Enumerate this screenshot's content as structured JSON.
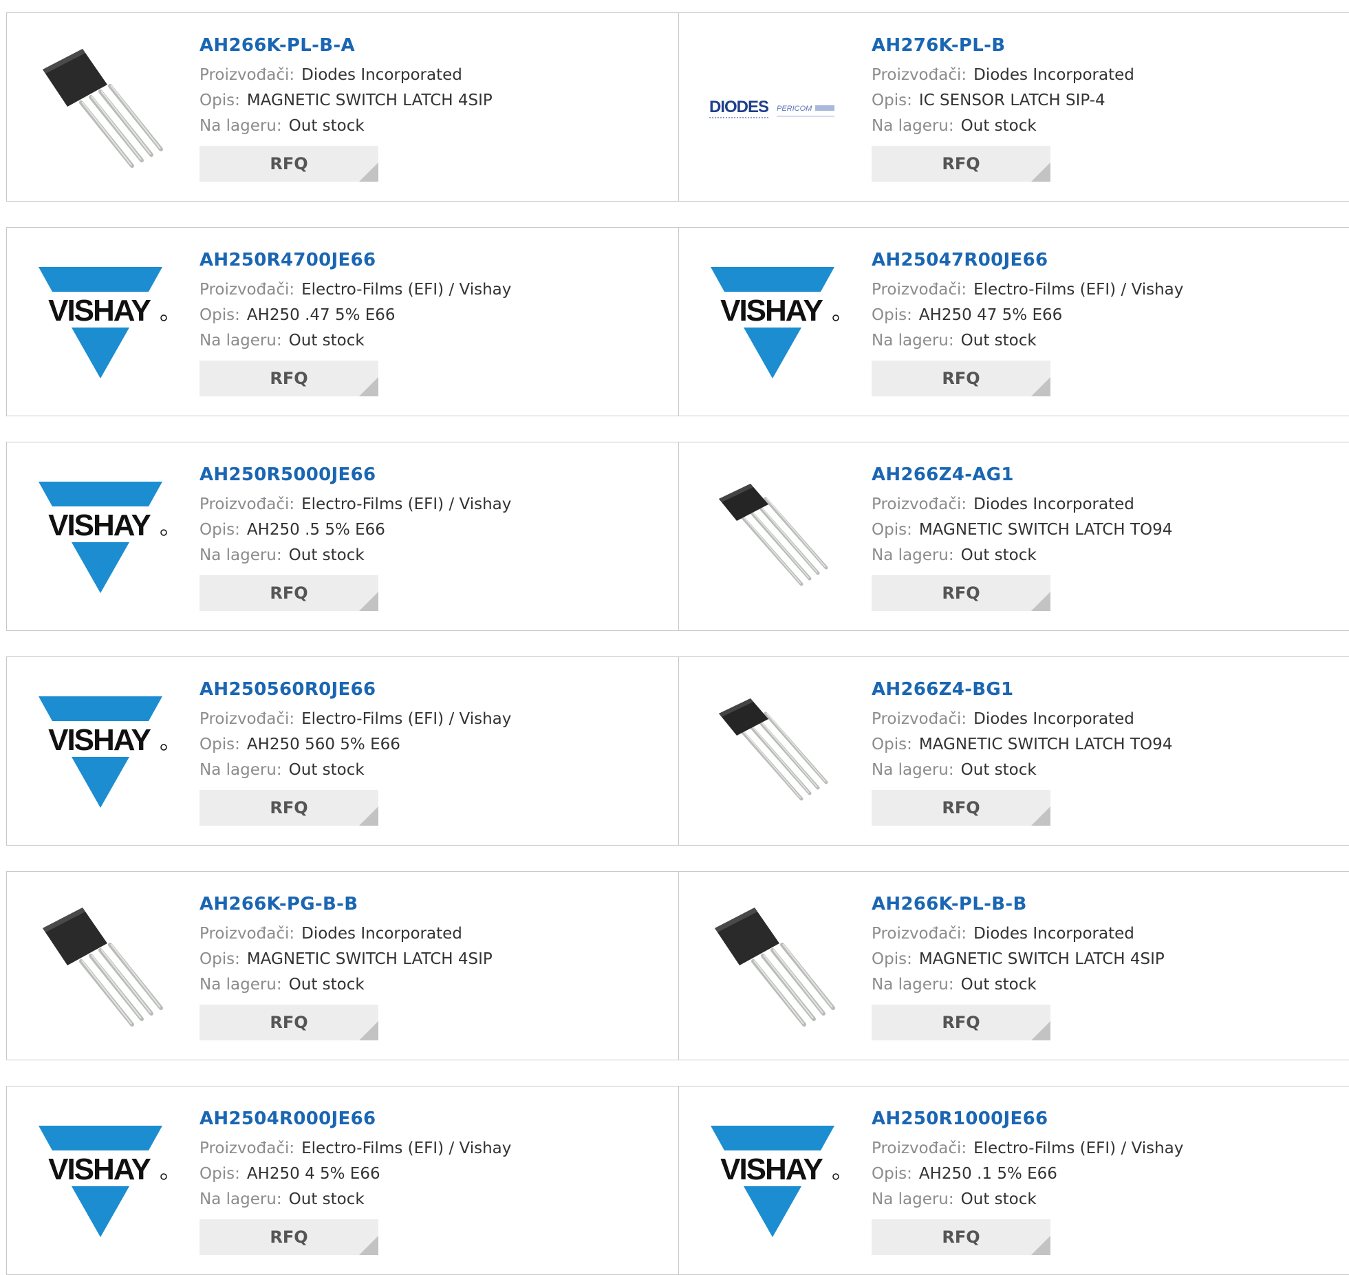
{
  "labels": {
    "manufacturer": "Proizvođači:",
    "description": "Opis:",
    "stock": "Na lageru:",
    "rfq": "RFQ"
  },
  "colors": {
    "part_link": "#1a66b3",
    "vishay_blue": "#1b8dd0",
    "rfq_bg": "#ededed"
  },
  "brand_text": {
    "vishay": "VISHAY",
    "diodes": "DIODES",
    "pericom": "PERICOM"
  },
  "products": [
    {
      "part": "AH266K-PL-B-A",
      "manufacturer": "Diodes Incorporated",
      "description": "MAGNETIC SWITCH LATCH 4SIP",
      "stock": "Out stock",
      "image": "sip4-chip"
    },
    {
      "part": "AH276K-PL-B",
      "manufacturer": "Diodes Incorporated",
      "description": "IC SENSOR LATCH SIP-4",
      "stock": "Out stock",
      "image": "diodes-logo"
    },
    {
      "part": "AH250R4700JE66",
      "manufacturer": "Electro-Films (EFI) / Vishay",
      "description": "AH250 .47 5% E66",
      "stock": "Out stock",
      "image": "vishay-logo"
    },
    {
      "part": "AH25047R00JE66",
      "manufacturer": "Electro-Films (EFI) / Vishay",
      "description": "AH250 47 5% E66",
      "stock": "Out stock",
      "image": "vishay-logo"
    },
    {
      "part": "AH250R5000JE66",
      "manufacturer": "Electro-Films (EFI) / Vishay",
      "description": "AH250 .5 5% E66",
      "stock": "Out stock",
      "image": "vishay-logo"
    },
    {
      "part": "AH266Z4-AG1",
      "manufacturer": "Diodes Incorporated",
      "description": "MAGNETIC SWITCH LATCH TO94",
      "stock": "Out stock",
      "image": "to94-chip"
    },
    {
      "part": "AH250560R0JE66",
      "manufacturer": "Electro-Films (EFI) / Vishay",
      "description": "AH250 560 5% E66",
      "stock": "Out stock",
      "image": "vishay-logo"
    },
    {
      "part": "AH266Z4-BG1",
      "manufacturer": "Diodes Incorporated",
      "description": "MAGNETIC SWITCH LATCH TO94",
      "stock": "Out stock",
      "image": "to94-chip"
    },
    {
      "part": "AH266K-PG-B-B",
      "manufacturer": "Diodes Incorporated",
      "description": "MAGNETIC SWITCH LATCH 4SIP",
      "stock": "Out stock",
      "image": "sip4-chip"
    },
    {
      "part": "AH266K-PL-B-B",
      "manufacturer": "Diodes Incorporated",
      "description": "MAGNETIC SWITCH LATCH 4SIP",
      "stock": "Out stock",
      "image": "sip4-chip"
    },
    {
      "part": "AH2504R000JE66",
      "manufacturer": "Electro-Films (EFI) / Vishay",
      "description": "AH250 4 5% E66",
      "stock": "Out stock",
      "image": "vishay-logo"
    },
    {
      "part": "AH250R1000JE66",
      "manufacturer": "Electro-Films (EFI) / Vishay",
      "description": "AH250 .1 5% E66",
      "stock": "Out stock",
      "image": "vishay-logo"
    }
  ]
}
